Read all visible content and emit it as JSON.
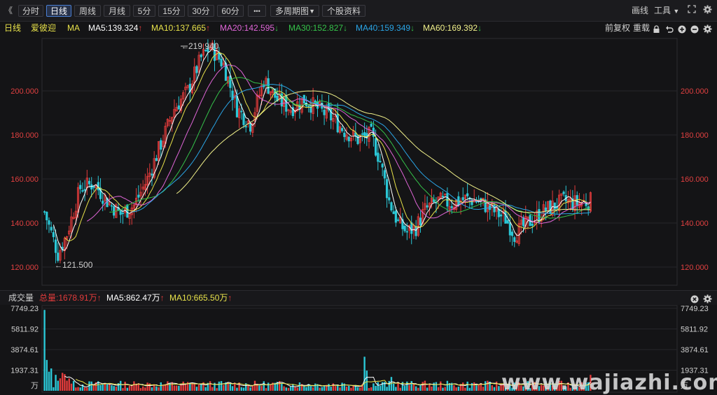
{
  "toolbar": {
    "back": "《",
    "periods": [
      {
        "label": "分时",
        "active": false
      },
      {
        "label": "日线",
        "active": true
      },
      {
        "label": "周线",
        "active": false
      },
      {
        "label": "月线",
        "active": false
      },
      {
        "label": "5分",
        "active": false
      },
      {
        "label": "15分",
        "active": false
      },
      {
        "label": "30分",
        "active": false
      },
      {
        "label": "60分",
        "active": false
      }
    ],
    "more": "•••",
    "multi_period": "多周期图",
    "stock_info": "个股资料",
    "draw": "画线",
    "tools": "工具"
  },
  "main_header": {
    "period": "日线",
    "name": "爱彼迎",
    "indicator": "MA",
    "ma": [
      {
        "label": "MA5:139.324",
        "dir": "↑",
        "color": "#ffffff"
      },
      {
        "label": "MA10:137.665",
        "dir": "↑",
        "color": "#e8e24a"
      },
      {
        "label": "MA20:142.595",
        "dir": "↓",
        "color": "#e066d8"
      },
      {
        "label": "MA30:152.827",
        "dir": "↓",
        "color": "#35c24a"
      },
      {
        "label": "MA40:159.349",
        "dir": "↓",
        "color": "#2aa5e6"
      },
      {
        "label": "MA60:169.392",
        "dir": "↓",
        "color": "#f0f08a"
      }
    ],
    "adjust": "前复权",
    "overlay": "重载"
  },
  "price_axis": {
    "labels": [
      "200.000",
      "180.000",
      "160.000",
      "140.000",
      "120.000"
    ],
    "values": [
      200,
      180,
      160,
      140,
      120
    ]
  },
  "annotations": {
    "high": "219.940",
    "low": "121.500"
  },
  "volume_header": {
    "title": "成交量",
    "total": "总量:1678.91万",
    "total_dir": "↑",
    "ma5": "MA5:862.47万",
    "ma5_dir": "↑",
    "ma10": "MA10:665.50万",
    "ma10_dir": "↑"
  },
  "volume_axis": {
    "labels": [
      "7749.23",
      "5811.92",
      "3874.61",
      "1937.31",
      "万"
    ]
  },
  "watermark": "www.wajiazhi.com",
  "colors": {
    "up": "#e23b3b",
    "down": "#2bc7d6",
    "ma5": "#ffffff",
    "ma10": "#e8e24a",
    "ma20": "#e066d8",
    "ma30": "#35c24a",
    "ma40": "#2aa5e6",
    "ma60": "#f0f08a",
    "axis_text_red": "#e04040"
  }
}
